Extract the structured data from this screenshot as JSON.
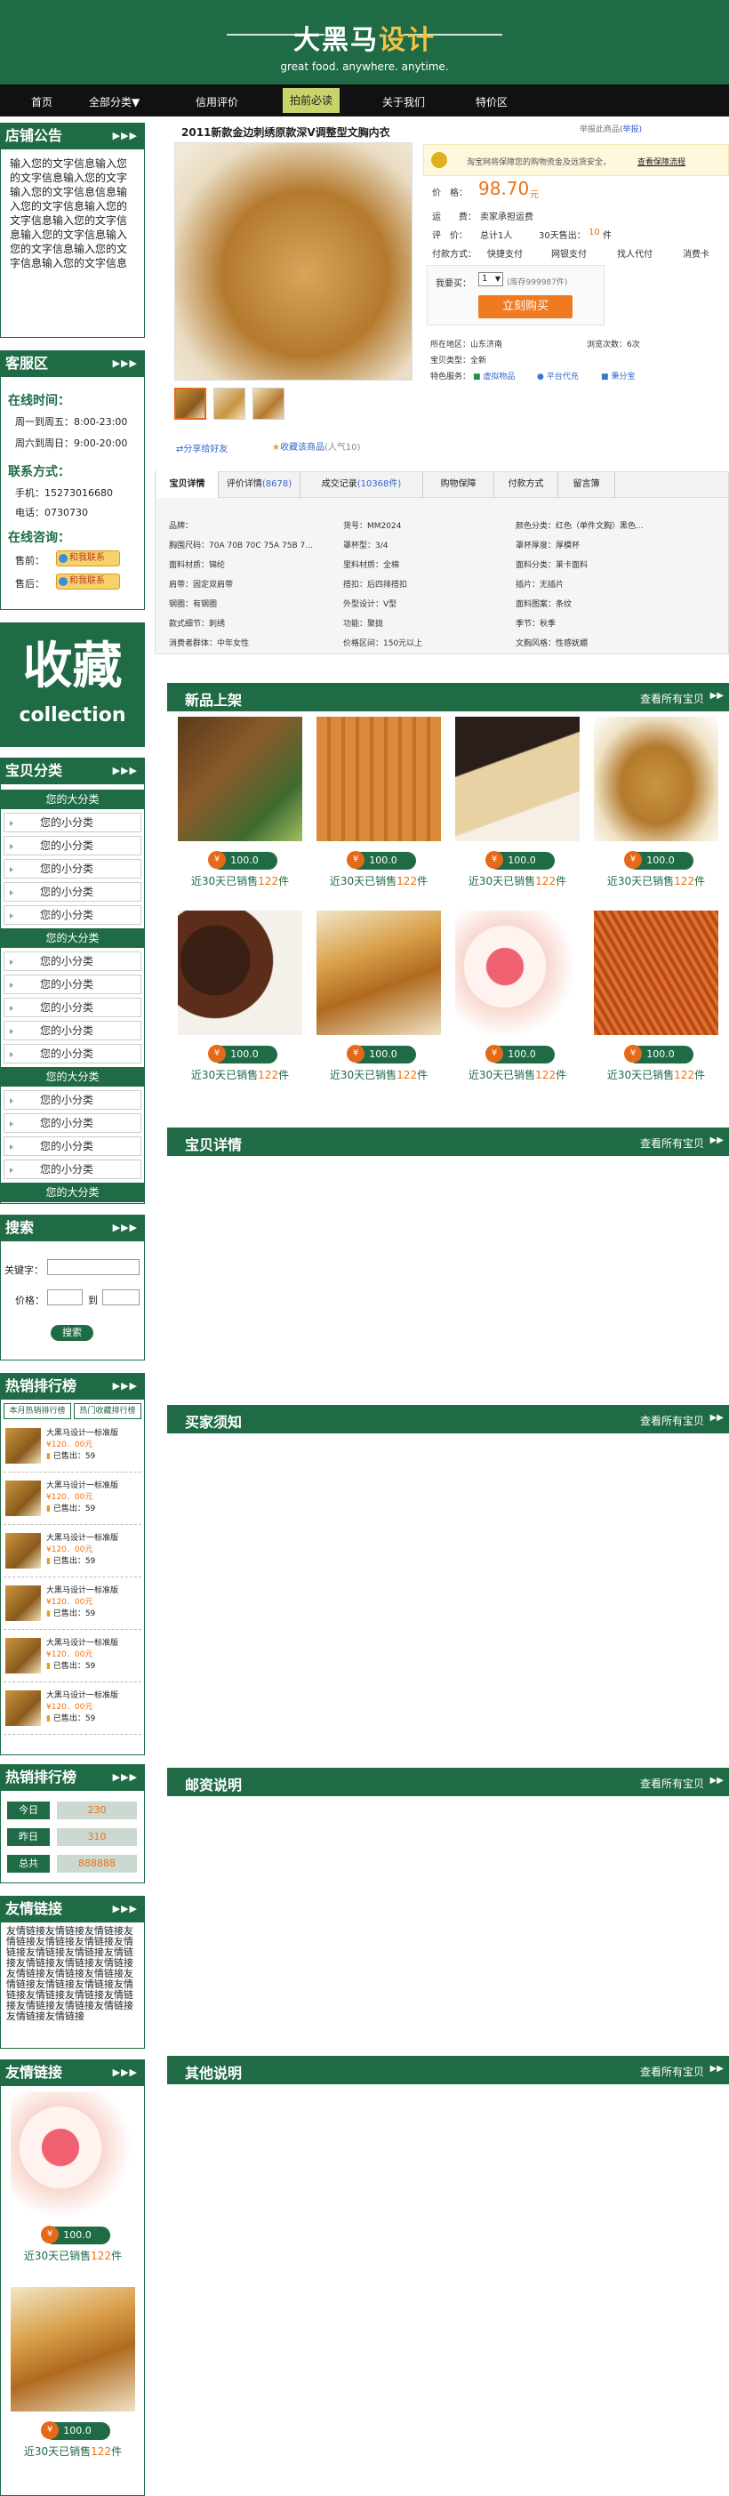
{
  "header": {
    "logo_a": "大黑马",
    "logo_b": "设计",
    "tagline": "great food. anywhere. anytime."
  },
  "nav": [
    "首页",
    "全部分类▼",
    "信用评价",
    "拍前必读",
    "关于我们",
    "特价区"
  ],
  "sidebar": {
    "notice_title": "店铺公告",
    "notice_text": "输入您的文字信息输入您的文字信息输入您的文字输入您的文字信息信息输入您的文字信息输入您的文字信息输入您的文字信息输入您的文字信息输入您的文字信息输入您的文字信息输入您的文字信息",
    "service_title": "客服区",
    "hours_title": "在线时间：",
    "hours1": "周一到周五：8:00-23:00",
    "hours2": "周六到周日：9:00-20:00",
    "contact_title": "联系方式：",
    "phone": "手机：15273016680",
    "tel": "电话：0730730",
    "consult_title": "在线咨询：",
    "pre_sale": "售前：",
    "after_sale": "售后：",
    "ww_label": "和我联系",
    "fav_big": "收藏",
    "fav_small": "collection",
    "cat_title": "宝贝分类",
    "big_cat": "您的大分类",
    "small_cat": "您的小分类",
    "search_title": "搜索",
    "kw_label": "关键字：",
    "price_label": "价格：",
    "to_label": "到",
    "search_btn": "搜索",
    "hot_title": "热销排行榜",
    "hot_tab1": "本月热销排行榜",
    "hot_tab2": "热门收藏排行榜",
    "rank_name": "大黑马设计一标准版",
    "rank_price": "¥120．00元",
    "rank_sold": "已售出：59",
    "hot2_title": "热销排行榜",
    "stats": [
      {
        "label": "今日",
        "value": "230"
      },
      {
        "label": "昨日",
        "value": "310"
      },
      {
        "label": "总共",
        "value": "888888"
      }
    ],
    "links_title": "友情链接",
    "links_text": "友情链接友情链接友情链接友情链接友情链接友情链接友情链接友情链接友情链接友情链接友情链接友情链接友情链接友情链接友情链接友情链接友情链接友情链接友情链接友情链接友情链接友情链接友情链接友情链接友情链接友情链接友情链接友情链接",
    "links2_title": "友情链接",
    "side_price": "100.0",
    "side_sold_a": "近30天已销售",
    "side_sold_b": "122",
    "side_sold_c": "件"
  },
  "product": {
    "title": "2011新款金边刺绣原款深V调整型文胸内衣",
    "report": "举报此商品",
    "report_link": "(举报)",
    "guarantee": "淘宝网将保障您的购物资金及远货安全，",
    "guarantee_link": "查看保障流程",
    "price_label": "价　格：",
    "price": "98.70",
    "price_unit": "元",
    "ship_label": "运　　费：",
    "ship_value": "卖家承担运费",
    "rating_label": "评　价：",
    "rating_value": "总计1人",
    "sold_label": "30天售出：",
    "sold_value": "10",
    "sold_unit": "件",
    "pay_label": "付款方式：",
    "pay_methods": [
      "快捷支付",
      "网银支付",
      "找人代付",
      "消费卡"
    ],
    "qty_label": "我要买：",
    "qty_value": "1",
    "stock": "(库存999987件)",
    "buy_btn": "立刻购买",
    "location": "所在地区：山东济南",
    "views": "浏览次数：6次",
    "condition": "宝贝类型：全新",
    "features_label": "特色服务：",
    "features": [
      "虚拟物品",
      "平台代充",
      "秉分宝"
    ],
    "share": "分享给好友",
    "collect": "收藏该商品",
    "popularity": "(人气10)",
    "tabs": [
      {
        "label": "宝贝详情",
        "count": ""
      },
      {
        "label": "评价详情",
        "count": "(8678)"
      },
      {
        "label": "成交记录",
        "count": "(10368件)"
      },
      {
        "label": "购物保障",
        "count": ""
      },
      {
        "label": "付款方式",
        "count": ""
      },
      {
        "label": "留言簿",
        "count": ""
      }
    ],
    "props": [
      [
        "品牌：",
        "货号：MM2024",
        "颜色分类：红色（单件文胸）黑色..."
      ],
      [
        "胸围尺码：70A 70B 70C 75A 75B 7...",
        "罩杯型：3/4",
        "罩杯厚度：厚模杯"
      ],
      [
        "面料材质：锦纶",
        "里料材质：全棉",
        "面料分类：莱卡面料"
      ],
      [
        "肩带：固定双肩带",
        "搭扣：后四排搭扣",
        "插片：无插片"
      ],
      [
        "钢圈：有钢圈",
        "外型设计：V型",
        "面料图案：条纹"
      ],
      [
        "款式细节：刺绣",
        "功能：聚拢",
        "季节：秋季"
      ],
      [
        "消费者群体：中年女性",
        "价格区间：150元以上",
        "文胸风格：性感妩媚"
      ]
    ]
  },
  "sections": {
    "new_title": "新品上架",
    "more": "查看所有宝贝",
    "detail_title": "宝贝详情",
    "notice_title": "买家须知",
    "postage_title": "邮资说明",
    "other_title": "其他说明"
  },
  "items": {
    "price": "100.0",
    "sold_a": "近30天已销售",
    "sold_b": "122",
    "sold_c": "件"
  }
}
